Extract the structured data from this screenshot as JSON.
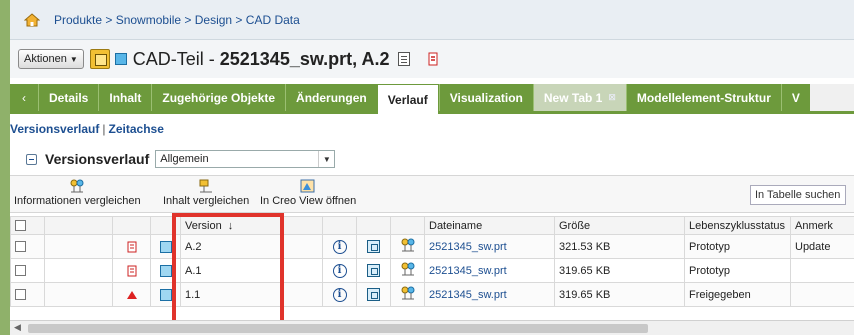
{
  "breadcrumb": {
    "text": "Produkte > Snowmobile > Design > CAD Data"
  },
  "object": {
    "actions_label": "Aktionen",
    "title_prefix": "CAD-Teil - ",
    "title_bold": "2521345_sw.prt, A.2"
  },
  "tabs": [
    {
      "label": "Details",
      "active": false
    },
    {
      "label": "Inhalt",
      "active": false
    },
    {
      "label": "Zugehörige Objekte",
      "active": false
    },
    {
      "label": "Änderungen",
      "active": false
    },
    {
      "label": "Verlauf",
      "active": true
    },
    {
      "label": "Visualization",
      "active": false
    },
    {
      "label": "New Tab 1",
      "active": false
    },
    {
      "label": "Modellelement-Struktur",
      "active": false
    },
    {
      "label": "V",
      "active": false
    }
  ],
  "subnav": {
    "link1": "Versionsverlauf",
    "separator": "|",
    "link2": "Zeitachse"
  },
  "section": {
    "title": "Versionsverlauf",
    "view_select": "Allgemein"
  },
  "toolbar": {
    "compare_info": "Informationen vergleichen",
    "compare_content": "Inhalt vergleichen",
    "open_creo": "In Creo View öffnen",
    "search_placeholder": "In Tabelle suchen"
  },
  "table": {
    "headers": {
      "version": "Version",
      "filename": "Dateiname",
      "size": "Größe",
      "lifecycle": "Lebenszyklusstatus",
      "notes": "Anmerk"
    },
    "rows": [
      {
        "version": "A.2",
        "filename": "2521345_sw.prt",
        "size": "321.53 KB",
        "status": "Prototyp",
        "notes": "Update"
      },
      {
        "version": "A.1",
        "filename": "2521345_sw.prt",
        "size": "319.65 KB",
        "status": "Prototyp",
        "notes": ""
      },
      {
        "version": "1.1",
        "filename": "2521345_sw.prt",
        "size": "319.65 KB",
        "status": "Freigegeben",
        "notes": ""
      }
    ]
  },
  "colors": {
    "tab_green": "#6d9a3c",
    "link_blue": "#1d4f91",
    "highlight_red": "#e0332b"
  }
}
